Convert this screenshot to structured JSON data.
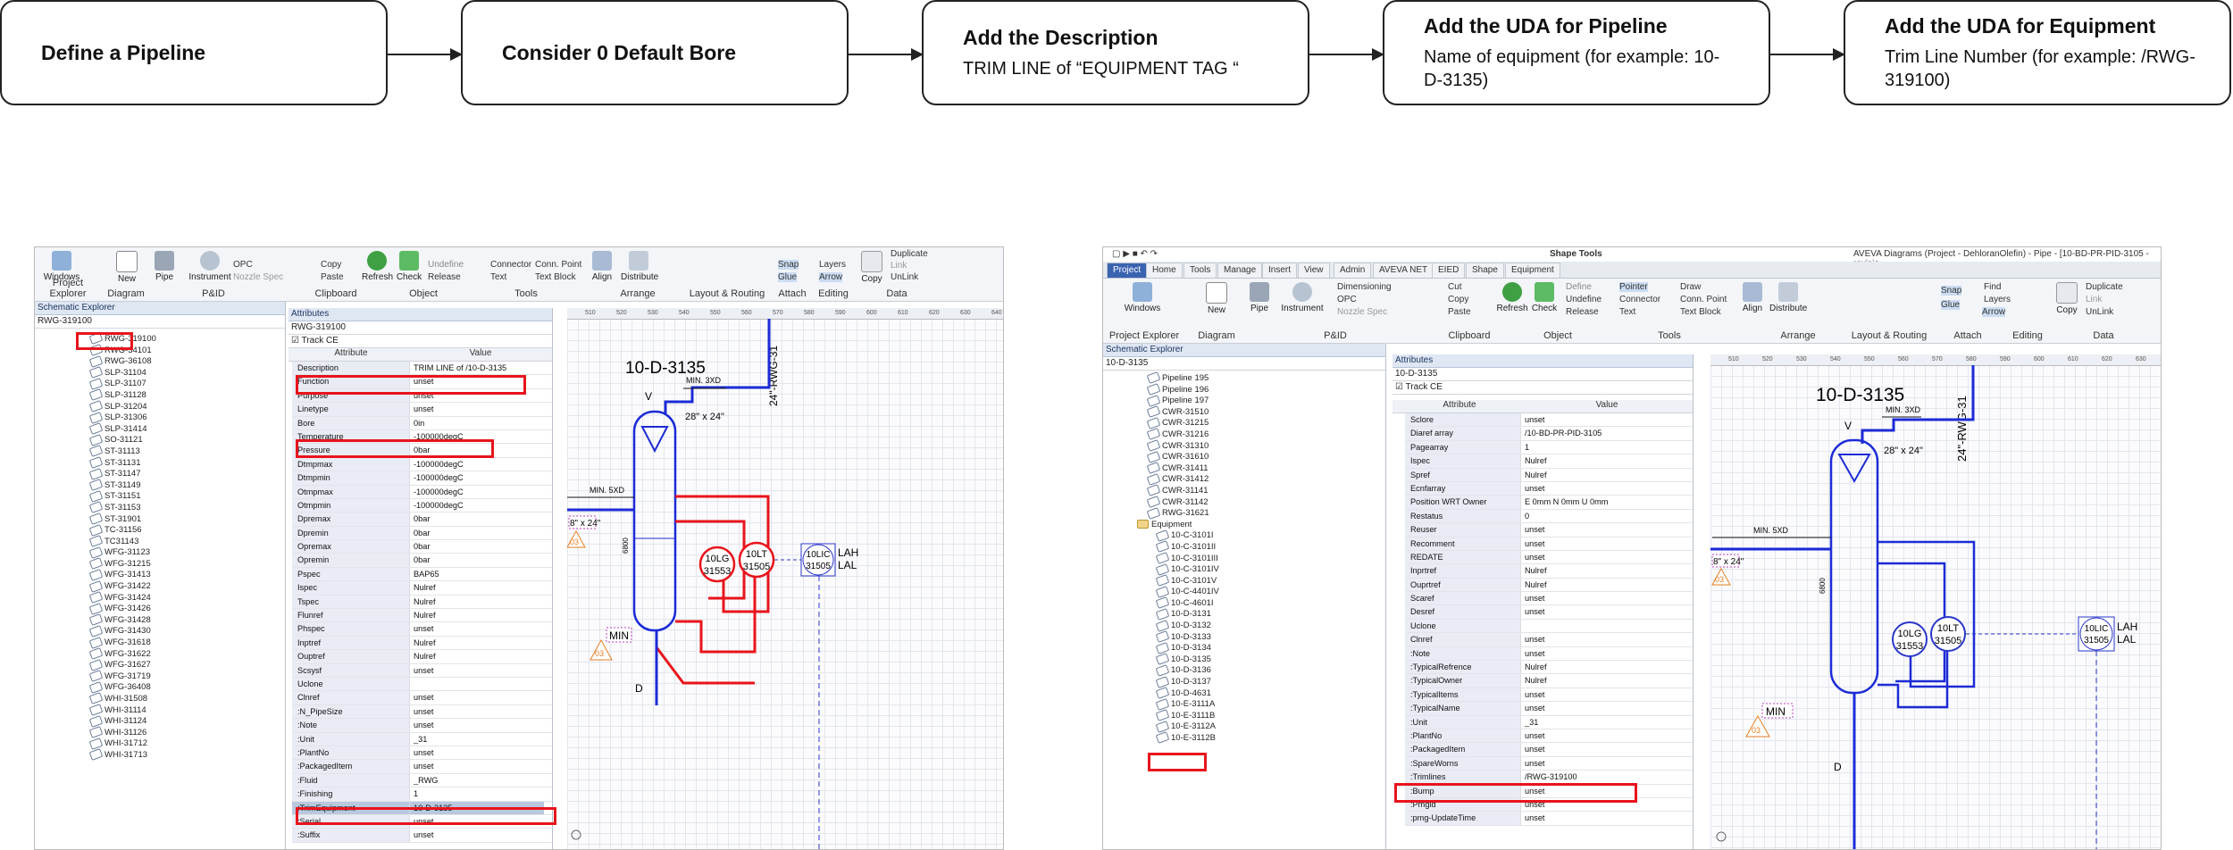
{
  "flow": {
    "steps": [
      {
        "title": "Define a Pipeline",
        "desc": ""
      },
      {
        "title": "Consider 0 Default Bore",
        "desc": ""
      },
      {
        "title": "Add the Description",
        "desc": "TRIM LINE of  “EQUIPMENT TAG “"
      },
      {
        "title": "Add the UDA for Pipeline",
        "desc": "Name of equipment (for example: 10-D-3135)"
      },
      {
        "title": "Add the UDA for Equipment",
        "desc": "Trim Line Number (for example: /RWG-319100)"
      }
    ]
  },
  "left": {
    "ribbon": {
      "buttons": [
        "Windows",
        "New",
        "Pipe",
        "Instrument",
        "Refresh",
        "Check",
        "Align",
        "Distribute",
        "Copy"
      ],
      "small": [
        "OPC",
        "Nozzle Spec",
        "Copy",
        "Paste",
        "Undefine",
        "Release",
        "Connector",
        "Conn. Point",
        "Text",
        "Text Block",
        "Snap",
        "Glue",
        "Layers",
        "Arrow",
        "Link",
        "UnLink",
        "Duplicate"
      ],
      "groups": [
        "Project Explorer",
        "Diagram",
        "P&ID",
        "Clipboard",
        "Object",
        "Tools",
        "Arrange",
        "Layout & Routing",
        "Attach",
        "Editing",
        "Data"
      ]
    },
    "explorer": {
      "title": "Schematic Explorer",
      "search": "RWG-319100",
      "items": [
        "RWG-319100",
        "RWG-34101",
        "RWG-36108",
        "SLP-31104",
        "SLP-31107",
        "SLP-31128",
        "SLP-31204",
        "SLP-31306",
        "SLP-31414",
        "SO-31121",
        "ST-31113",
        "ST-31131",
        "ST-31147",
        "ST-31149",
        "ST-31151",
        "ST-31153",
        "ST-31901",
        "TC-31156",
        "TC31143",
        "WFG-31123",
        "WFG-31215",
        "WFG-31413",
        "WFG-31422",
        "WFG-31424",
        "WFG-31426",
        "WFG-31428",
        "WFG-31430",
        "WFG-31618",
        "WFG-31622",
        "WFG-31627",
        "WFG-31719",
        "WFG-36408",
        "WHI-31508",
        "WHI-31114",
        "WHI-31124",
        "WHI-31126",
        "WHI-31712",
        "WHI-31713"
      ]
    },
    "attributes": {
      "title": "Attributes",
      "owner": "RWG-319100",
      "trackce": "Track CE",
      "col_attr": "Attribute",
      "col_value": "Value",
      "rows": [
        [
          "Description",
          "TRIM LINE of /10-D-3135"
        ],
        [
          "Function",
          "unset"
        ],
        [
          "Purpose",
          "unset"
        ],
        [
          "Linetype",
          "unset"
        ],
        [
          "Bore",
          "0in"
        ],
        [
          "Temperature",
          "-100000degC"
        ],
        [
          "Pressure",
          "0bar"
        ],
        [
          "Dtmpmax",
          "-100000degC"
        ],
        [
          "Dtmpmin",
          "-100000degC"
        ],
        [
          "Otmpmax",
          "-100000degC"
        ],
        [
          "Otmpmin",
          "-100000degC"
        ],
        [
          "Dpremax",
          "0bar"
        ],
        [
          "Dpremin",
          "0bar"
        ],
        [
          "Opremax",
          "0bar"
        ],
        [
          "Opremin",
          "0bar"
        ],
        [
          "Pspec",
          "BAP65"
        ],
        [
          "Ispec",
          "Nulref"
        ],
        [
          "Tspec",
          "Nulref"
        ],
        [
          "Flunref",
          "Nulref"
        ],
        [
          "Phspec",
          "unset"
        ],
        [
          "Inptref",
          "Nulref"
        ],
        [
          "Ouptref",
          "Nulref"
        ],
        [
          "Scsysf",
          "unset"
        ],
        [
          "Uclone",
          ""
        ],
        [
          "Clnref",
          "unset"
        ],
        [
          ":N_PipeSize",
          "unset"
        ],
        [
          ":Note",
          "unset"
        ],
        [
          ":Unit",
          "_31"
        ],
        [
          ":PlantNo",
          "unset"
        ],
        [
          ":PackagedItem",
          "unset"
        ],
        [
          ":Fluid",
          "_RWG"
        ],
        [
          ":Finishing",
          "1"
        ],
        [
          ":TrimEquipment",
          "10-D-3135"
        ],
        [
          ":Serial",
          "unset"
        ],
        [
          ":Suffix",
          "unset"
        ]
      ]
    },
    "diagram": {
      "vessel_tag": "10-D-3135",
      "line_label": "24\"-RWG-31",
      "min_3xd": "MIN. 3XD",
      "min_5xd": "MIN. 5XD",
      "red1": "28\" x 24\"",
      "red2": "8\" x 24\"",
      "nozzle_v": "V",
      "nozzle_d": "D",
      "tri": "03",
      "min": "MIN",
      "instr1": [
        "10LG",
        "31553"
      ],
      "instr2": [
        "10LT",
        "31505"
      ],
      "instr3": [
        "10LIC",
        "31505"
      ],
      "alarm": [
        "LAH",
        "LAL"
      ],
      "dim": "6800",
      "ruler": [
        "510",
        "520",
        "530",
        "540",
        "550",
        "560",
        "570",
        "580",
        "590",
        "600",
        "610",
        "620",
        "630",
        "640"
      ]
    }
  },
  "right": {
    "title": "AVEVA Diagrams (Project - DehloranOlefin) - Pipe - [10-BD-PR-PID-3105 - revisio",
    "shape_tools": "Shape Tools",
    "tabs": [
      "Project",
      "Home",
      "Tools",
      "Manage",
      "Insert",
      "View",
      "Admin",
      "AVEVA NET",
      "EIED",
      "Shape",
      "Equipment"
    ],
    "ribbon": {
      "buttons": [
        "Windows",
        "New",
        "Pipe",
        "Instrument",
        "Refresh",
        "Check",
        "Align",
        "Distribute",
        "Copy"
      ],
      "small": [
        "Dimensioning",
        "OPC",
        "Nozzle Spec",
        "Cut",
        "Copy",
        "Paste",
        "Define",
        "Undefine",
        "Release",
        "Pointer",
        "Connector",
        "Text",
        "Draw",
        "Conn. Point",
        "Text Block",
        "Snap",
        "Glue",
        "Arrow",
        "Find",
        "Layers",
        "Link",
        "Duplicate",
        "UnLink"
      ],
      "groups": [
        "Project Explorer",
        "Diagram",
        "P&ID",
        "Clipboard",
        "Object",
        "Tools",
        "Arrange",
        "Layout & Routing",
        "Attach",
        "Editing",
        "Data"
      ]
    },
    "explorer": {
      "title": "Schematic Explorer",
      "search": "10-D-3135",
      "items": [
        "Pipeline 195",
        "Pipeline 196",
        "Pipeline 197",
        "CWR-31510",
        "CWR-31215",
        "CWR-31216",
        "CWR-31310",
        "CWR-31610",
        "CWR-31411",
        "CWR-31412",
        "CWR-31141",
        "CWR-31142",
        "RWG-31621",
        "Equipment",
        "10-C-3101I",
        "10-C-3101II",
        "10-C-3101III",
        "10-C-3101IV",
        "10-C-3101V",
        "10-C-4401IV",
        "10-C-4601I",
        "10-D-3131",
        "10-D-3132",
        "10-D-3133",
        "10-D-3134",
        "10-D-3135",
        "10-D-3136",
        "10-D-3137",
        "10-D-4631",
        "10-E-3111A",
        "10-E-3111B",
        "10-E-3112A",
        "10-E-3112B"
      ]
    },
    "attributes": {
      "title": "Attributes",
      "owner": "10-D-3135",
      "trackce": "Track CE",
      "col_attr": "Attribute",
      "col_value": "Value",
      "rows": [
        [
          "Sclore",
          "unset"
        ],
        [
          "Diaref array",
          "/10-BD-PR-PID-3105"
        ],
        [
          "Pagearray",
          "1"
        ],
        [
          "Ispec",
          "Nulref"
        ],
        [
          "Spref",
          "Nulref"
        ],
        [
          "Ecnfarray",
          "unset"
        ],
        [
          "Position WRT Owner",
          "E 0mm N 0mm U 0mm"
        ],
        [
          "Restatus",
          "0"
        ],
        [
          "Reuser",
          "unset"
        ],
        [
          "Recomment",
          "unset"
        ],
        [
          "REDATE",
          "unset"
        ],
        [
          "Inprtref",
          "Nulref"
        ],
        [
          "Ouprtref",
          "Nulref"
        ],
        [
          "Scaref",
          "unset"
        ],
        [
          "Desref",
          "unset"
        ],
        [
          "Uclone",
          ""
        ],
        [
          "Clnref",
          "unset"
        ],
        [
          ":Note",
          "unset"
        ],
        [
          ":TypicalRefrence",
          "Nulref"
        ],
        [
          ":TypicalOwner",
          "Nulref"
        ],
        [
          ":TypicalItems",
          "unset"
        ],
        [
          ":TypicalName",
          "unset"
        ],
        [
          ":Unit",
          "_31"
        ],
        [
          ":PlantNo",
          "unset"
        ],
        [
          ":PackagedItem",
          "unset"
        ],
        [
          ":SpareWorns",
          "unset"
        ],
        [
          ":Trimlines",
          "/RWG-319100"
        ],
        [
          ":Bump",
          "unset"
        ],
        [
          ":Pmgid",
          "unset"
        ],
        [
          ":pmg-UpdateTime",
          "unset"
        ]
      ]
    },
    "diagram": {
      "vessel_tag": "10-D-3135",
      "line_label": "24\"-RWG-31",
      "min_3xd": "MIN. 3XD",
      "min_5xd": "MIN. 5XD",
      "red1": "28\" x 24\"",
      "red2": "8\" x 24\"",
      "nozzle_v": "V",
      "nozzle_d": "D",
      "tri": "03",
      "min": "MIN",
      "instr1": [
        "10LG",
        "31553"
      ],
      "instr2": [
        "10LT",
        "31505"
      ],
      "instr3": [
        "10LIC",
        "31505"
      ],
      "alarm": [
        "LAH",
        "LAL"
      ],
      "dim": "6800",
      "ruler": [
        "510",
        "520",
        "530",
        "540",
        "550",
        "560",
        "570",
        "580",
        "590",
        "600",
        "610",
        "620",
        "630"
      ]
    }
  },
  "colors": {
    "highlight_red": "#e8141c",
    "pipe_blue": "#1c2bd6",
    "tag_red": "#e8141c",
    "instrument_blue": "#2a37c9"
  }
}
